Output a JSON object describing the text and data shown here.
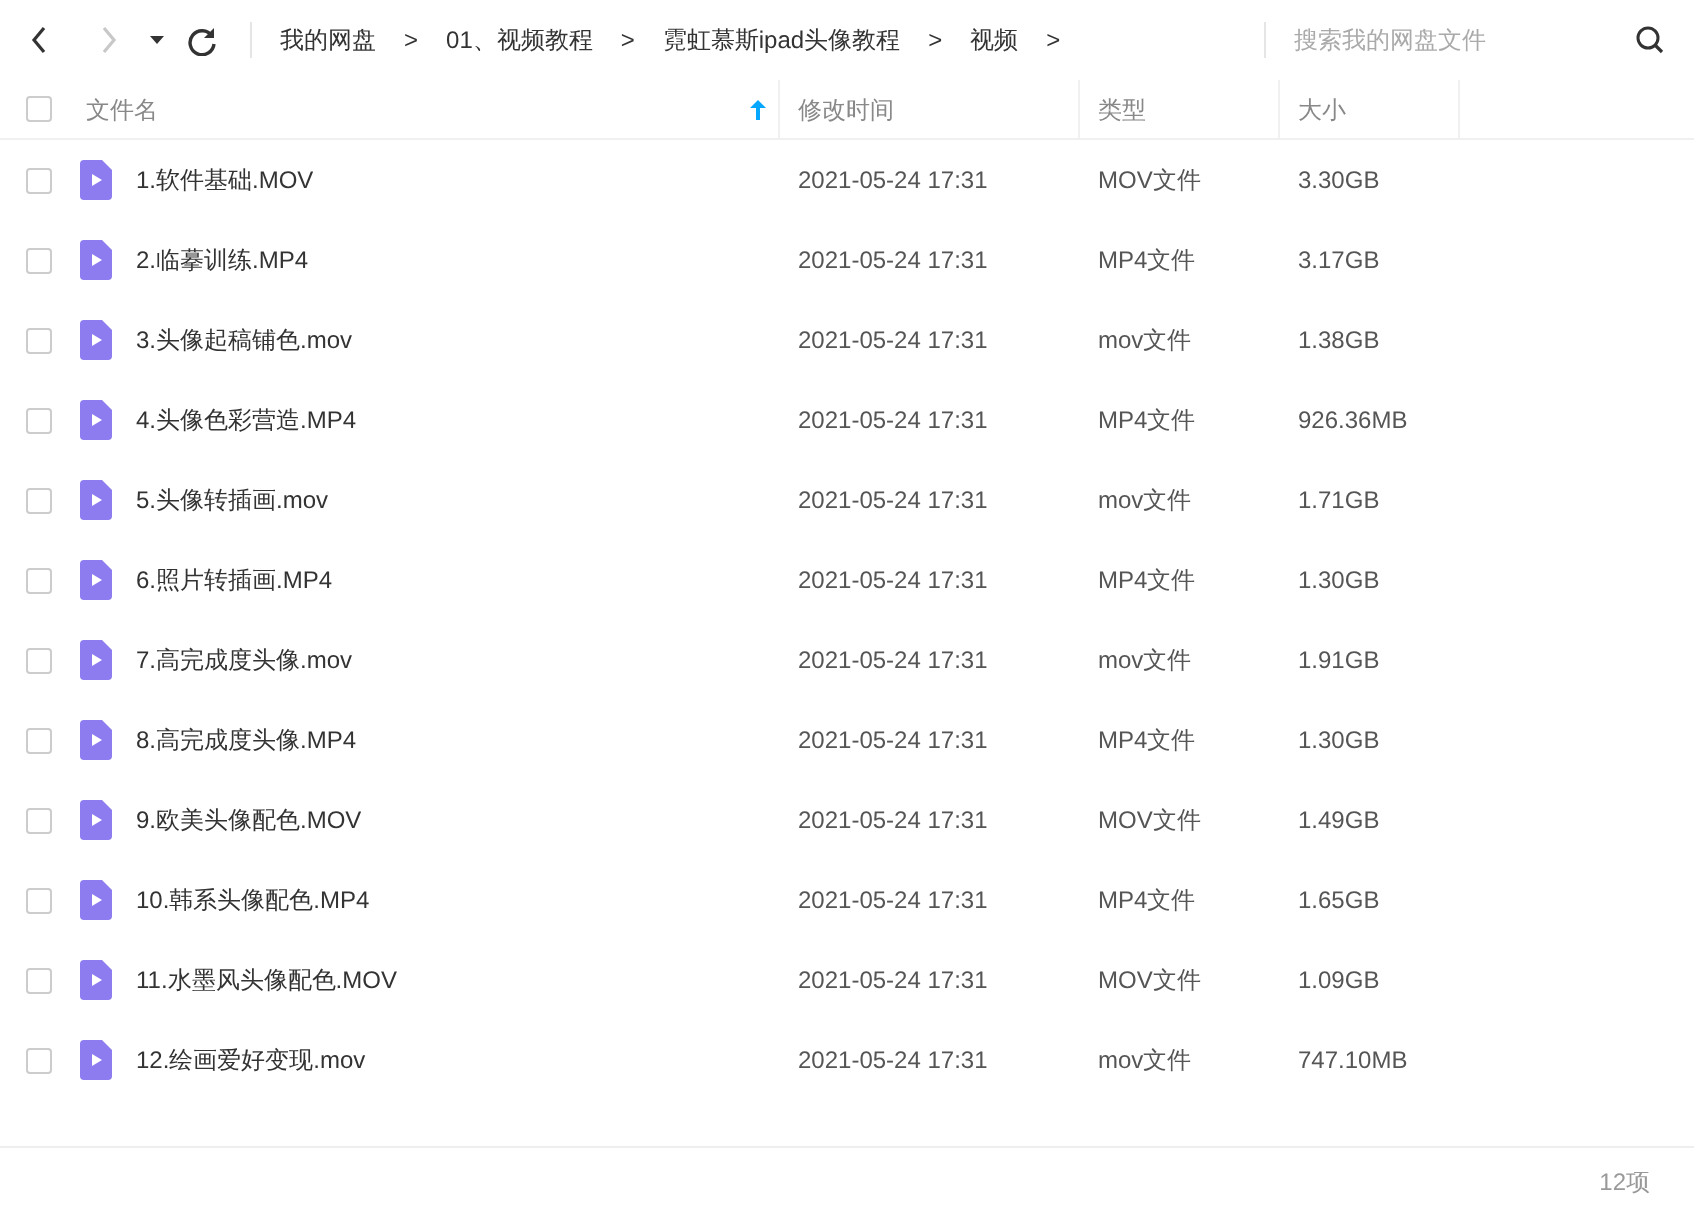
{
  "toolbar": {
    "nav": [
      {
        "kind": "back",
        "disabled": false
      },
      {
        "kind": "forward",
        "disabled": true
      },
      {
        "kind": "dropdown",
        "disabled": false
      },
      {
        "kind": "refresh",
        "disabled": false
      }
    ],
    "breadcrumbs": [
      "我的网盘",
      "01、视频教程",
      "霓虹慕斯ipad头像教程",
      "视频"
    ],
    "separator": ">",
    "search": {
      "placeholder": "搜索我的网盘文件"
    }
  },
  "table": {
    "select_all": {
      "checked": false
    },
    "columns": [
      {
        "label": "文件名",
        "sorted": true
      },
      {
        "label": "修改时间",
        "sorted": false
      },
      {
        "label": "类型",
        "sorted": false
      },
      {
        "label": "大小",
        "sorted": false
      }
    ],
    "rows": [
      {
        "checked": false,
        "name": "1.软件基础.MOV",
        "modified": "2021-05-24 17:31",
        "type": "MOV文件",
        "size": "3.30GB"
      },
      {
        "checked": false,
        "name": "2.临摹训练.MP4",
        "modified": "2021-05-24 17:31",
        "type": "MP4文件",
        "size": "3.17GB"
      },
      {
        "checked": false,
        "name": "3.头像起稿铺色.mov",
        "modified": "2021-05-24 17:31",
        "type": "mov文件",
        "size": "1.38GB"
      },
      {
        "checked": false,
        "name": "4.头像色彩营造.MP4",
        "modified": "2021-05-24 17:31",
        "type": "MP4文件",
        "size": "926.36MB"
      },
      {
        "checked": false,
        "name": "5.头像转插画.mov",
        "modified": "2021-05-24 17:31",
        "type": "mov文件",
        "size": "1.71GB"
      },
      {
        "checked": false,
        "name": "6.照片转插画.MP4",
        "modified": "2021-05-24 17:31",
        "type": "MP4文件",
        "size": "1.30GB"
      },
      {
        "checked": false,
        "name": "7.高完成度头像.mov",
        "modified": "2021-05-24 17:31",
        "type": "mov文件",
        "size": "1.91GB"
      },
      {
        "checked": false,
        "name": "8.高完成度头像.MP4",
        "modified": "2021-05-24 17:31",
        "type": "MP4文件",
        "size": "1.30GB"
      },
      {
        "checked": false,
        "name": "9.欧美头像配色.MOV",
        "modified": "2021-05-24 17:31",
        "type": "MOV文件",
        "size": "1.49GB"
      },
      {
        "checked": false,
        "name": "10.韩系头像配色.MP4",
        "modified": "2021-05-24 17:31",
        "type": "MP4文件",
        "size": "1.65GB"
      },
      {
        "checked": false,
        "name": "11.水墨风头像配色.MOV",
        "modified": "2021-05-24 17:31",
        "type": "MOV文件",
        "size": "1.09GB"
      },
      {
        "checked": false,
        "name": "12.绘画爱好变现.mov",
        "modified": "2021-05-24 17:31",
        "type": "mov文件",
        "size": "747.10MB"
      }
    ]
  },
  "status_bar": {
    "count": "12项"
  }
}
